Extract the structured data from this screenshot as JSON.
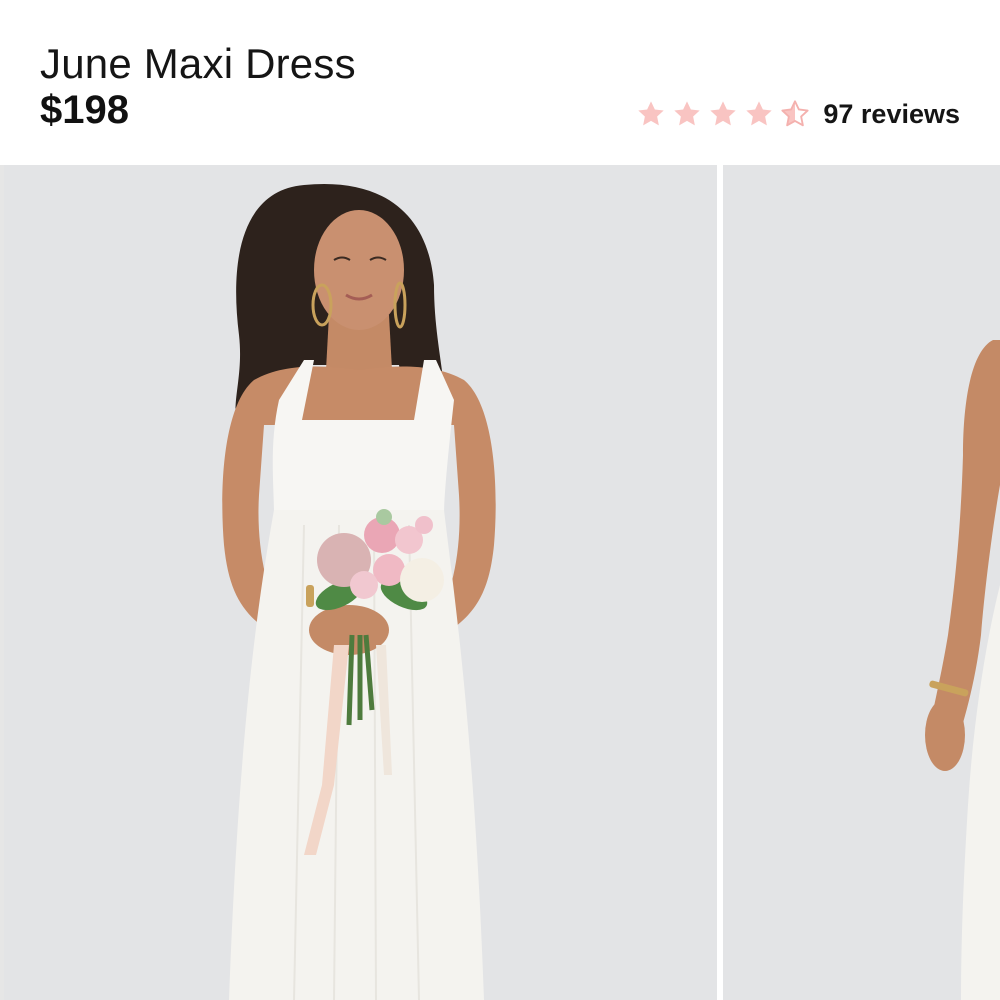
{
  "product": {
    "title": "June Maxi Dress",
    "price": "$198",
    "rating": 4.5,
    "rating_max": 5,
    "reviews_label": "97 reviews"
  },
  "icons": {
    "star": "star-icon",
    "half_star": "half-star-icon"
  },
  "colors": {
    "star_fill": "#f9c4c2",
    "star_outline": "#f4b1ae",
    "photo_background": "#e3e4e6",
    "text": "#151515"
  },
  "gallery": {
    "images": [
      {
        "alt": "Model wearing white maxi dress holding a bouquet"
      },
      {
        "alt": "Side view of white maxi dress"
      }
    ]
  }
}
